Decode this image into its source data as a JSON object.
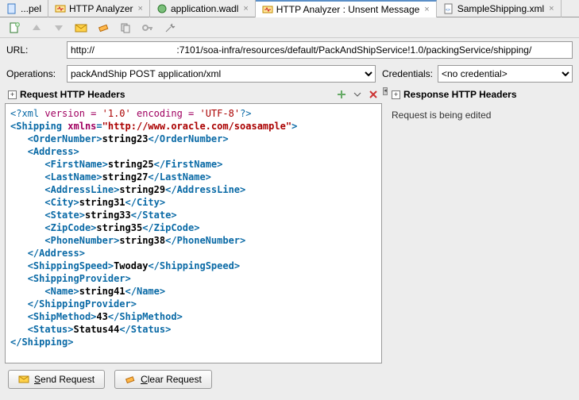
{
  "tabs": [
    {
      "label": "...pel",
      "icon": "file-blue"
    },
    {
      "label": "HTTP Analyzer",
      "icon": "analyzer"
    },
    {
      "label": "application.wadl",
      "icon": "wadl"
    },
    {
      "label": "HTTP Analyzer : Unsent Message",
      "icon": "analyzer",
      "active": true
    },
    {
      "label": "SampleShipping.xml",
      "icon": "xml"
    }
  ],
  "url_label": "URL:",
  "url_value": "http://                               :7101/soa-infra/resources/default/PackAndShipService!1.0/packingService/shipping/",
  "operations_label": "Operations:",
  "operations_value": "packAndShip POST application/xml",
  "credentials_label": "Credentials:",
  "credentials_value": "<no credential>",
  "request_header_title": "Request HTTP Headers",
  "response_header_title": "Response HTTP Headers",
  "response_status_text": "Request is being edited",
  "send_button": "Send Request",
  "clear_button": "Clear Request",
  "xml": {
    "version": "1.0",
    "encoding": "UTF-8",
    "root": "Shipping",
    "xmlns": "http://www.oracle.com/soasample",
    "OrderNumber": "string23",
    "Address": {
      "FirstName": "string25",
      "LastName": "string27",
      "AddressLine": "string29",
      "City": "string31",
      "State": "string33",
      "ZipCode": "string35",
      "PhoneNumber": "string38"
    },
    "ShippingSpeed": "Twoday",
    "ShippingProvider": {
      "Name": "string41"
    },
    "ShipMethod": "43",
    "Status": "Status44"
  }
}
